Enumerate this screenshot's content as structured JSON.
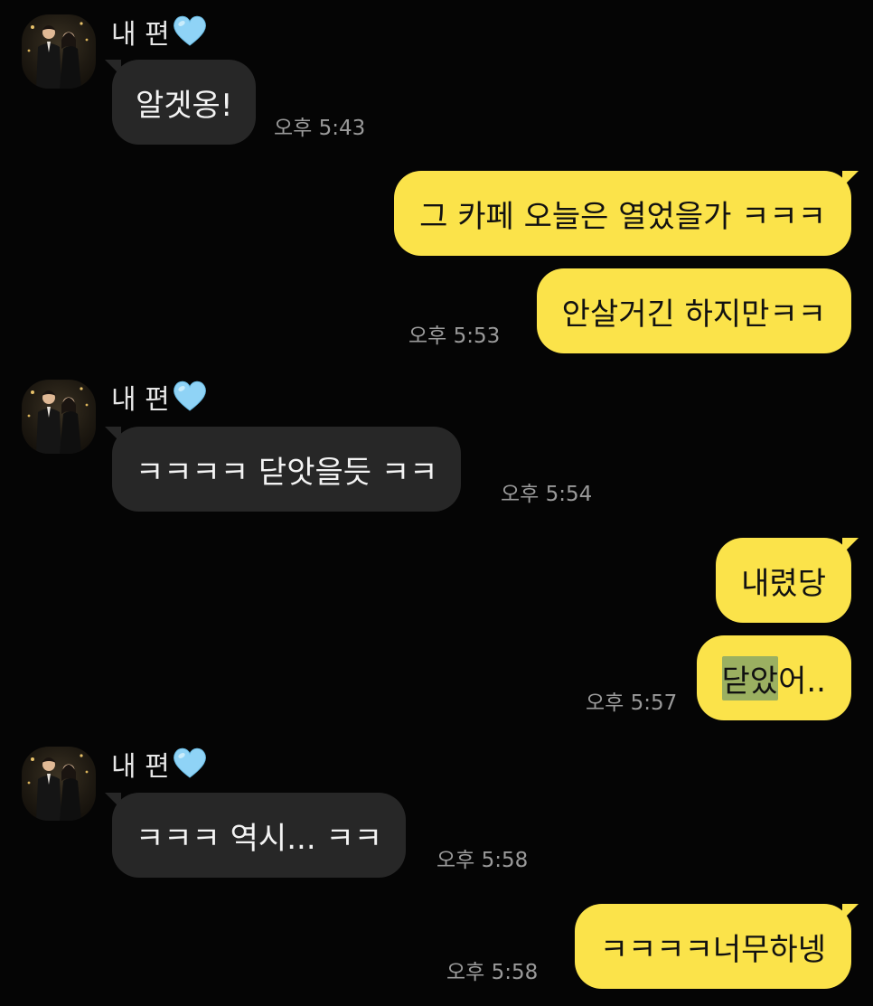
{
  "contact": {
    "name": "내 편",
    "heart_icon": "light-blue-heart-icon",
    "heart_color": "#8fd3f6"
  },
  "colors": {
    "background": "#050505",
    "incoming_bubble": "#272727",
    "outgoing_bubble": "#fbe34a",
    "highlight": "#9bb061"
  },
  "messages": [
    {
      "direction": "incoming",
      "show_sender": true,
      "text": "알겟옹!",
      "time": "오후 5:43"
    },
    {
      "direction": "outgoing",
      "text": "그 카페 오늘은 열었을가 ㅋㅋㅋ",
      "time": ""
    },
    {
      "direction": "outgoing",
      "text": "안살거긴 하지만ㅋㅋ",
      "time": "오후 5:53"
    },
    {
      "direction": "incoming",
      "show_sender": true,
      "text": "ㅋㅋㅋㅋ 닫앗을듯 ㅋㅋ",
      "time": "오후 5:54"
    },
    {
      "direction": "outgoing",
      "text": "내렸당",
      "time": ""
    },
    {
      "direction": "outgoing",
      "text_highlighted": "닫았",
      "text_rest": "어..",
      "time": "오후 5:57"
    },
    {
      "direction": "incoming",
      "show_sender": true,
      "text": "ㅋㅋㅋ 역시... ㅋㅋ",
      "time": "오후 5:58"
    },
    {
      "direction": "outgoing",
      "text": "ㅋㅋㅋㅋ너무하넹",
      "time": "오후 5:58"
    }
  ]
}
